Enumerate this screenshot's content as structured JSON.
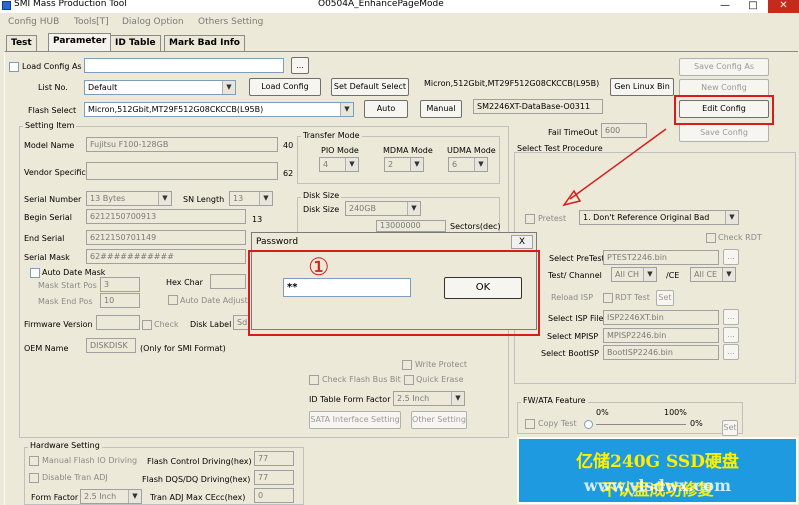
{
  "window": {
    "app_title": "SMI Mass Production Tool",
    "doc_title": "O0504A_EnhancePageMode"
  },
  "menu": [
    "Config HUB",
    "Tools[T]",
    "Dialog Option",
    "Others Setting"
  ],
  "tabs": [
    "Test",
    "Parameter",
    "ID Table",
    "Mark Bad Info"
  ],
  "top": {
    "load_config_as": "Load Config As",
    "browse": "...",
    "list_no_label": "List No.",
    "list_no_value": "Default",
    "load_config": "Load Config",
    "set_default_select": "Set Default Select",
    "flash_info": "Micron,512Gbit,MT29F512G08CKCCB(L95B)",
    "gen_linux_bin": "Gen Linux Bin",
    "flash_select_label": "Flash Select",
    "flash_select_value": "Micron,512Gbit,MT29F512G08CKCCB(L95B)",
    "auto": "Auto",
    "manual": "Manual",
    "database": "SM2246XT-DataBase-O0311",
    "save_config_as": "Save Config As",
    "new_config": "New Config",
    "edit_config": "Edit Config",
    "save_config": "Save Config",
    "fail_timeout_label": "Fail TimeOut",
    "fail_timeout_value": "600"
  },
  "setting": {
    "group_title": "Setting Item",
    "model_name_label": "Model Name",
    "model_name_value": "Fujitsu F100-128GB",
    "model_name_len": "40",
    "vendor_specific_label": "Vendor Specific",
    "vendor_specific_len": "62",
    "serial_number_label": "Serial Number",
    "serial_number_value": "13 Bytes",
    "sn_length_label": "SN Length",
    "sn_length_value": "13",
    "begin_serial_label": "Begin Serial",
    "begin_serial_value": "6212150700913",
    "begin_serial_len": "13",
    "end_serial_label": "End Serial",
    "end_serial_value": "6212150701149",
    "serial_mask_label": "Serial Mask",
    "serial_mask_value": "62###########",
    "auto_date_mask": "Auto Date Mask",
    "mask_start_pos_label": "Mask Start Pos",
    "mask_start_pos_value": "3",
    "mask_end_pos_label": "Mask End Pos",
    "mask_end_pos_value": "10",
    "hex_char_label": "Hex Char",
    "auto_date_adjust": "Auto Date Adjust",
    "firmware_version_label": "Firmware Version",
    "check": "Check",
    "disk_label_label": "Disk Label",
    "disk_label_value": "Sd",
    "oem_name_label": "OEM Name",
    "oem_name_value": "DISKDISK",
    "oem_note": "(Only for SMI Format)"
  },
  "transfer": {
    "title": "Transfer Mode",
    "pio_label": "PIO Mode",
    "pio_value": "4",
    "mdma_label": "MDMA Mode",
    "mdma_value": "2",
    "udma_label": "UDMA Mode",
    "udma_value": "6"
  },
  "disk": {
    "title": "Disk Size",
    "size_label": "Disk Size",
    "size_value": "240GB",
    "row2_value": "13000000",
    "row2_right": "Sectors(dec)"
  },
  "misc": {
    "write_protect": "Write Protect",
    "check_flash_bus_bit": "Check Flash Bus Bit",
    "quick_erase": "Quick Erase",
    "id_table_form_factor_label": "ID Table Form Factor",
    "id_table_form_factor_value": "2.5 Inch",
    "sata_interface_setting": "SATA Interface Setting",
    "other_setting": "Other Setting"
  },
  "hardware": {
    "title": "Hardware Setting",
    "manual_flash_io": "Manual Flash IO Driving",
    "flash_control_label": "Flash Control Driving(hex)",
    "flash_control_value": "77",
    "disable_tran_adj": "Disable Tran ADJ",
    "flash_dqs_label": "Flash DQS/DQ Driving(hex)",
    "flash_dqs_value": "77",
    "form_factor_label": "Form Factor",
    "form_factor_value": "2.5 Inch",
    "tran_adj_label": "Tran ADJ Max CEcc(hex)",
    "tran_adj_value": "0"
  },
  "procedure": {
    "title": "Select Test Procedure",
    "pretest": "Pretest",
    "pretest_mode": "1. Don't Reference Original Bad",
    "check_rdt": "Check RDT",
    "select_pretest_label": "Select PreTest",
    "select_pretest_value": "PTEST2246.bin",
    "test_channel_label": "Test/ Channel",
    "channel_value": "All CH",
    "ce_label": "/CE",
    "ce_value": "All CE",
    "reload_isp": "Reload ISP",
    "rdt_test": "RDT Test",
    "set": "Set",
    "select_isp_label": "Select ISP File",
    "select_isp_value": "ISP2246XT.bin",
    "select_mpisp_label": "Select MPISP",
    "select_mpisp_value": "MPISP2246.bin",
    "select_bootisp_label": "Select BootISP",
    "select_bootisp_value": "BootISP2246.bin",
    "browse": "..."
  },
  "fwata": {
    "title": "FW/ATA Feature",
    "pct_0": "0%",
    "pct_100": "100%",
    "copy_test": "Copy Test",
    "pct_right": "0%",
    "set": "Set"
  },
  "password_dialog": {
    "title": "Password",
    "close": "X",
    "annotation": "①",
    "input_value": "**",
    "ok": "OK"
  },
  "watermark": {
    "line1": "亿储240G SSD硬盘",
    "line2": "不认盘成功修复",
    "line2_overlay": "www.ylsdwx.com"
  },
  "colors": {
    "highlight_red": "#d81b1b",
    "watermark_blue": "#1e9be0",
    "watermark_text": "#ffee00"
  }
}
